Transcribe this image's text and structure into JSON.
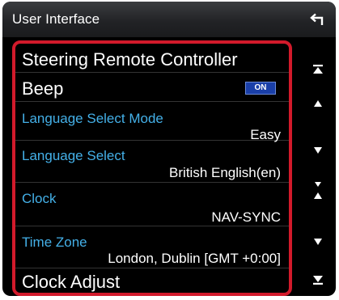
{
  "header": {
    "title": "User Interface"
  },
  "items": {
    "steering": {
      "label": "Steering Remote Controller"
    },
    "beep": {
      "label": "Beep",
      "toggle": "ON"
    },
    "language_mode": {
      "label": "Language Select Mode",
      "value": "Easy"
    },
    "language_select": {
      "label": "Language Select",
      "value": "British English(en)"
    },
    "clock": {
      "label": "Clock",
      "value": "NAV-SYNC"
    },
    "time_zone": {
      "label": "Time Zone",
      "value": "London, Dublin [GMT +0:00]"
    },
    "clock_adjust": {
      "label": "Clock Adjust"
    }
  },
  "icons": {
    "back": "back-arrow-icon",
    "scroll_top": "scroll-to-top-icon",
    "page_up": "page-up-icon",
    "page_down": "page-down-icon",
    "scroll_bottom": "scroll-to-bottom-icon"
  },
  "colors": {
    "highlight_border": "#d21a2b",
    "label_blue": "#44b0e8",
    "toggle_on": "#1a3fa8"
  }
}
